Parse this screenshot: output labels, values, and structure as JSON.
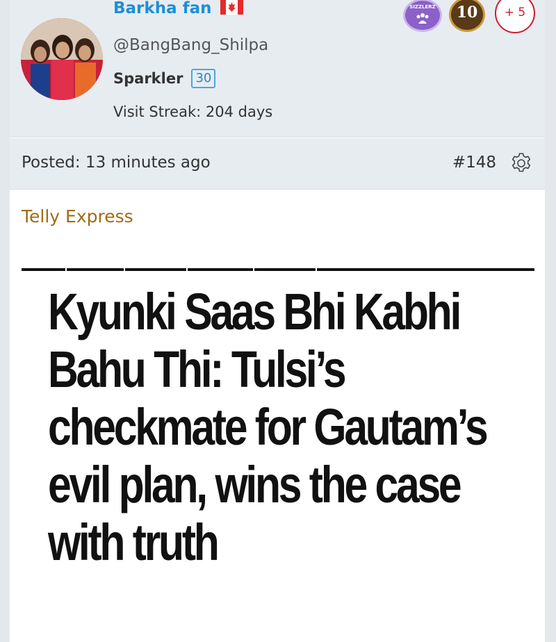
{
  "user": {
    "display_name": "Barkha fan",
    "flag_icon": "canada-flag-icon",
    "handle": "@BangBang_Shilpa",
    "rank": "Sparkler",
    "rank_level": "30",
    "visit_streak": "Visit Streak: 204 days"
  },
  "badges": {
    "sizzlerz_label": "SIZZLERZ",
    "level_badge": "10",
    "more_count": "+ 5"
  },
  "post": {
    "posted": "Posted: 13 minutes ago",
    "number": "#148",
    "settings_icon": "gear-icon"
  },
  "content": {
    "source": "Telly Express",
    "headline": "Kyunki Saas Bhi Kabhi Bahu Thi: Tulsi’s checkmate for Gautam’s evil plan, wins the case with truth"
  },
  "colors": {
    "username": "#1f8ed6",
    "source": "#a26a12",
    "header_bg": "#e7ecf1",
    "more_badge": "#c91f35"
  }
}
